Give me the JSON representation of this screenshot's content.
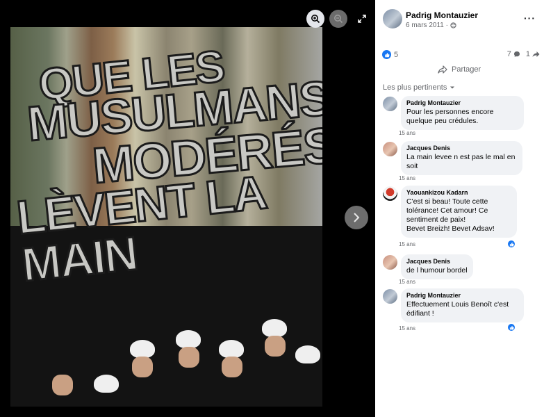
{
  "viewer": {
    "poster_lines": [
      "Que les",
      "Musulmans",
      "Modérés",
      "Lèvent la main"
    ],
    "controls": [
      "zoom-in-icon",
      "zoom-out-icon",
      "expand-icon",
      "chevron-right-icon"
    ]
  },
  "post": {
    "author": "Padrig Montauzier",
    "date": "6 mars 2011 ·",
    "privacy_icon": "globe-icon",
    "more_label": "···",
    "reactions_count": "5",
    "comments_count": "7",
    "shares_count": "1",
    "share_label": "Partager",
    "sort_label": "Les plus pertinents"
  },
  "comments": [
    {
      "name": "Padrig Montauzier",
      "text": "Pour les personnes encore\nquelque peu crédules.",
      "time": "15 ans",
      "liked": false
    },
    {
      "name": "Jacques Denis",
      "text": "La main levee n est pas le mal en\nsoit",
      "time": "15 ans",
      "liked": false
    },
    {
      "name": "Yaouankizou Kadarn",
      "text": "C'est si beau! Toute cette\ntolérance! Cet amour! Ce\nsentiment de paix!\nBevet Breizh! Bevet Adsav!",
      "time": "15 ans",
      "liked": true
    },
    {
      "name": "Jacques Denis",
      "text": "de l humour bordel",
      "time": "15 ans",
      "liked": false
    },
    {
      "name": "Padrig Montauzier",
      "text": "Effectuement Louis Benoît c'est\nédifiant !",
      "time": "15 ans",
      "liked": true
    }
  ],
  "colors": {
    "accent": "#1877f2",
    "bubble": "#f0f2f5",
    "muted": "#65676b",
    "viewer_bg": "#000000"
  }
}
